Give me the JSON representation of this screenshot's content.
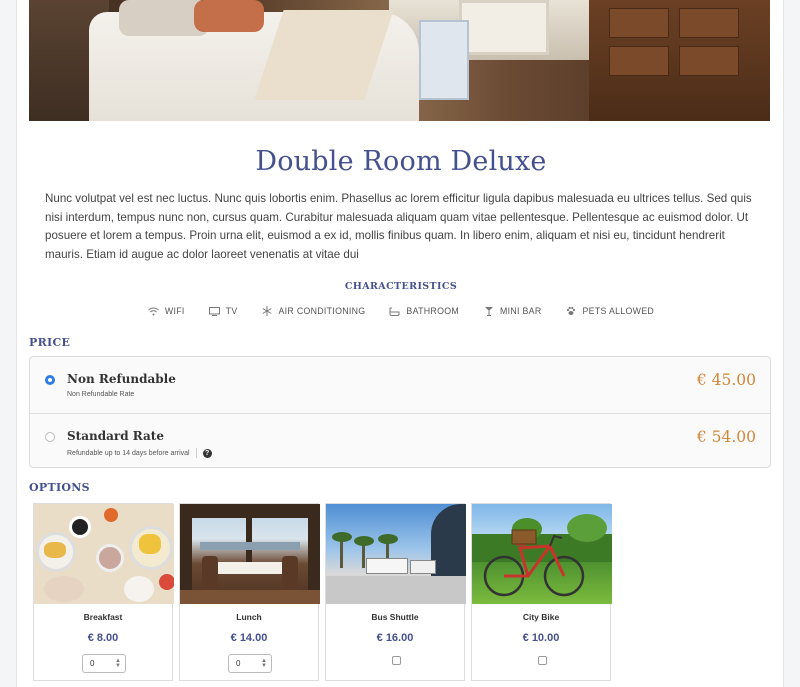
{
  "room": {
    "title": "Double Room Deluxe",
    "description": "Nunc volutpat vel est nec luctus. Nunc quis lobortis enim. Phasellus ac lorem efficitur ligula dapibus malesuada eu ultrices tellus. Sed quis nisi interdum, tempus nunc non, cursus quam. Curabitur malesuada aliquam quam vitae pellentesque. Pellentesque ac euismod dolor. Ut posuere et lorem a tempus. Proin urna elit, euismod a ex id, mollis finibus quam. In libero enim, aliquam et nisi eu, tincidunt hendrerit mauris. Etiam id augue ac dolor laoreet venenatis at vitae dui"
  },
  "characteristics": {
    "heading": "CHARACTERISTICS",
    "items": [
      {
        "label": "WIFI",
        "icon": "wifi-icon"
      },
      {
        "label": "TV",
        "icon": "tv-icon"
      },
      {
        "label": "AIR CONDITIONING",
        "icon": "snowflake-icon"
      },
      {
        "label": "BATHROOM",
        "icon": "bathtub-icon"
      },
      {
        "label": "MINI BAR",
        "icon": "cocktail-icon"
      },
      {
        "label": "PETS ALLOWED",
        "icon": "paw-icon"
      }
    ]
  },
  "price": {
    "heading": "PRICE",
    "rates": [
      {
        "name": "Non Refundable",
        "sub": "Non Refundable Rate",
        "amount": "€ 45.00",
        "selected": true
      },
      {
        "name": "Standard Rate",
        "sub": "Refundable up to 14 days before arrival",
        "amount": "€ 54.00",
        "selected": false,
        "help": "?"
      }
    ]
  },
  "options": {
    "heading": "OPTIONS",
    "items": [
      {
        "label": "Breakfast",
        "price": "€ 8.00",
        "control": "quantity",
        "value": "0"
      },
      {
        "label": "Lunch",
        "price": "€ 14.00",
        "control": "quantity",
        "value": "0"
      },
      {
        "label": "Bus Shuttle",
        "price": "€ 16.00",
        "control": "checkbox",
        "checked": false
      },
      {
        "label": "City Bike",
        "price": "€ 10.00",
        "control": "checkbox",
        "checked": false
      }
    ]
  },
  "colors": {
    "accent": "#45508f",
    "price": "#d1873a",
    "radio": "#2f7ee6"
  }
}
